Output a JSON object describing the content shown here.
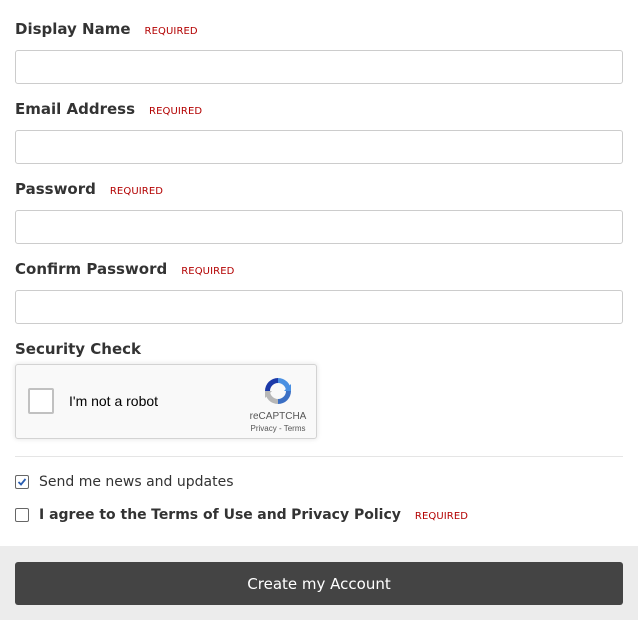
{
  "required_label": "REQUIRED",
  "fields": [
    {
      "label": "Display Name",
      "value": "",
      "placeholder": ""
    },
    {
      "label": "Email Address",
      "value": "",
      "placeholder": ""
    },
    {
      "label": "Password",
      "value": "",
      "placeholder": ""
    },
    {
      "label": "Confirm Password",
      "value": "",
      "placeholder": ""
    }
  ],
  "security": {
    "label": "Security Check",
    "captcha_text": "I'm not a robot",
    "captcha_brand": "reCAPTCHA",
    "captcha_privacy": "Privacy",
    "captcha_sep": " - ",
    "captcha_terms": "Terms",
    "captcha_checked": false
  },
  "options": {
    "news": {
      "label": "Send me news and updates",
      "checked": true
    },
    "agree": {
      "prefix": "I agree to the",
      "terms": "Terms of Use",
      "and": "and",
      "privacy": "Privacy Policy",
      "checked": false
    }
  },
  "submit_label": "Create my Account",
  "colors": {
    "required": "#b30000",
    "button": "#444444",
    "footer": "#ececec",
    "checkmark": "#2a5db0"
  }
}
